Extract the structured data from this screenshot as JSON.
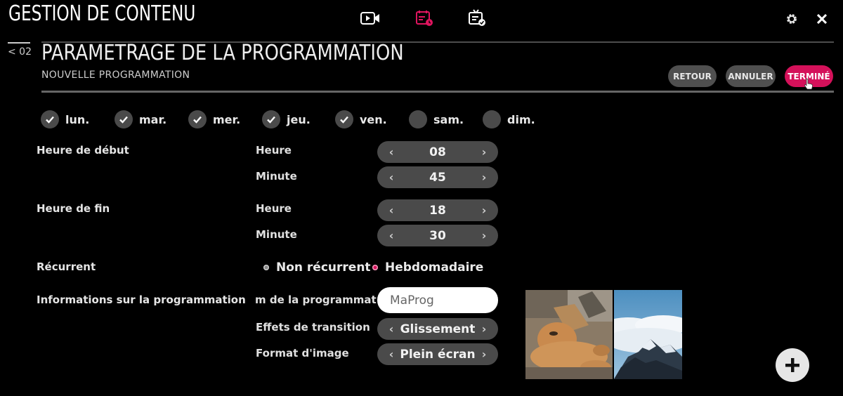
{
  "app": {
    "title": "GESTION DE CONTENU"
  },
  "nav": {
    "back_label": "< 02",
    "icons": [
      "video-icon",
      "schedule-icon",
      "tv-check-icon"
    ],
    "active_icon": "schedule-icon"
  },
  "header": {
    "title": "PARAMETRAGE DE LA PROGRAMMATION",
    "subtitle": "NOUVELLE PROGRAMMATION",
    "buttons": {
      "retour": "RETOUR",
      "annuler": "ANNULER",
      "termine": "TERMINÉ"
    }
  },
  "days": [
    {
      "label": "lun.",
      "checked": true
    },
    {
      "label": "mar.",
      "checked": true
    },
    {
      "label": "mer.",
      "checked": true
    },
    {
      "label": "jeu.",
      "checked": true
    },
    {
      "label": "ven.",
      "checked": true
    },
    {
      "label": "sam.",
      "checked": false
    },
    {
      "label": "dim.",
      "checked": false
    }
  ],
  "start_time": {
    "label": "Heure de début",
    "hour_label": "Heure",
    "hour": "08",
    "minute_label": "Minute",
    "minute": "45"
  },
  "end_time": {
    "label": "Heure de fin",
    "hour_label": "Heure",
    "hour": "18",
    "minute_label": "Minute",
    "minute": "30"
  },
  "recurrence": {
    "label": "Récurrent",
    "options": [
      "Non récurrent",
      "Hebdomadaire"
    ],
    "selected": "Hebdomadaire"
  },
  "info": {
    "label": "Informations sur la programmation",
    "name_label": "m de la programmation",
    "name_value": "MaProg",
    "transition_label": "Effets de transition",
    "transition_value": "Glissement",
    "format_label": "Format d'image",
    "format_value": "Plein écran"
  },
  "thumbnails": [
    "lion-thumbnail",
    "mountain-clouds-thumbnail"
  ],
  "colors": {
    "accent": "#d4115a",
    "button_grey": "#4f4f4f",
    "stepper_grey": "#4a4a4a",
    "background": "#000000"
  }
}
